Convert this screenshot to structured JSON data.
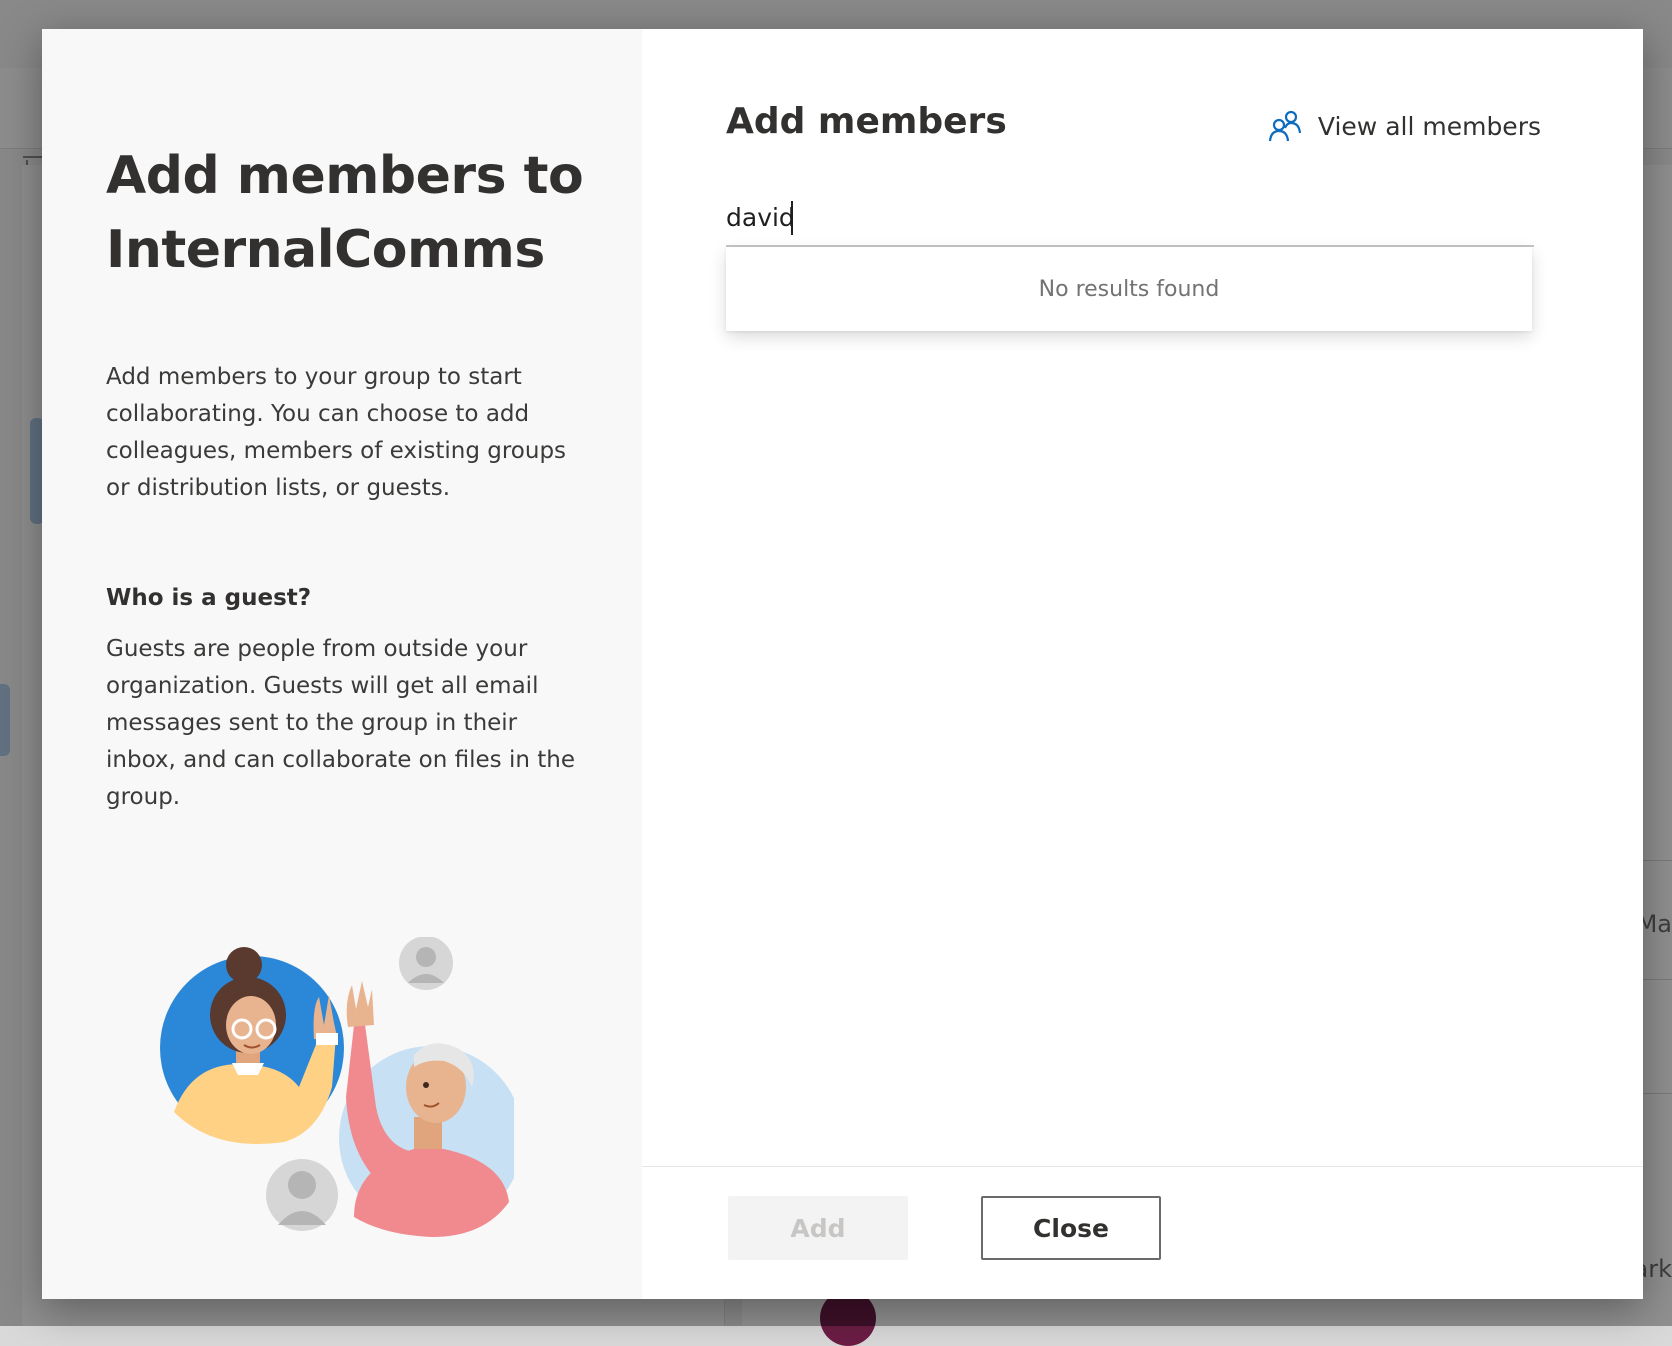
{
  "background": {
    "right_text_1": "Ma",
    "right_text_2": "ark"
  },
  "dialog": {
    "title": "Add members to InternalComms",
    "description": "Add members to your group to start collaborating. You can choose to add colleagues, members of existing groups or distribution lists, or guests.",
    "guest_heading": "Who is a guest?",
    "guest_description": "Guests are people from outside your organization. Guests will get all email messages sent to the group in their inbox, and can collaborate on files in the group.",
    "panel_title": "Add members",
    "view_all_label": "View all members",
    "view_all_icon": "people-icon",
    "search_value": "david",
    "search_placeholder": "",
    "no_results": "No results found",
    "add_label": "Add",
    "close_label": "Close"
  },
  "colors": {
    "accent": "#0f6cbd",
    "left_panel_bg": "#f8f8f8",
    "text_primary": "#323130",
    "disabled_bg": "#f3f3f3",
    "disabled_text": "#c8c6c4"
  }
}
